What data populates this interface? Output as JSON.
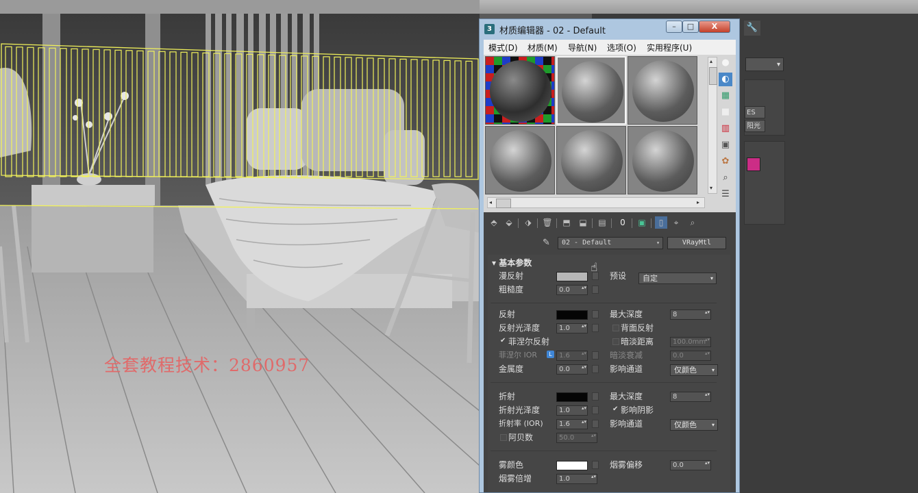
{
  "window": {
    "title": "材质编辑器 - 02 - Default",
    "icon_label": "3",
    "controls": {
      "minimize": "–",
      "maximize": "□",
      "close": "X"
    }
  },
  "menu": [
    "模式(D)",
    "材质(M)",
    "导航(N)",
    "选项(O)",
    "实用程序(U)"
  ],
  "slots": [
    {
      "selected": false,
      "checker": true
    },
    {
      "selected": true,
      "checker": false
    },
    {
      "selected": false,
      "checker": false
    },
    {
      "selected": false,
      "checker": false
    },
    {
      "selected": false,
      "checker": false
    },
    {
      "selected": false,
      "checker": false
    }
  ],
  "material": {
    "name": "02 - Default",
    "type": "VRayMtl"
  },
  "rollout": {
    "title": "基本参数",
    "diffuse": {
      "label": "漫反射",
      "color": "#b7b7b7"
    },
    "roughness": {
      "label": "粗糙度",
      "value": "0.0"
    },
    "preset": {
      "label": "预设",
      "value": "自定"
    },
    "reflect": {
      "label": "反射",
      "color": "#050505"
    },
    "reflect_gloss": {
      "label": "反射光泽度",
      "value": "1.0"
    },
    "fresnel": {
      "label": "菲涅尔反射",
      "checked": true
    },
    "fresnel_ior": {
      "label": "菲涅尔 IOR",
      "badge": "L",
      "value": "1.6"
    },
    "metalness": {
      "label": "金属度",
      "value": "0.0"
    },
    "max_depth_reflect": {
      "label": "最大深度",
      "value": "8"
    },
    "back_reflect": {
      "label": "背面反射",
      "checked": false
    },
    "dim_distance": {
      "label": "暗淡距离",
      "value": "100.0mm",
      "checked": false
    },
    "dim_falloff": {
      "label": "暗淡衰减",
      "value": "0.0"
    },
    "affect_channels_reflect": {
      "label": "影响通道",
      "value": "仅颜色"
    },
    "refract": {
      "label": "折射",
      "color": "#050505"
    },
    "refract_gloss": {
      "label": "折射光泽度",
      "value": "1.0"
    },
    "ior": {
      "label": "折射率 (IOR)",
      "value": "1.6"
    },
    "abbe": {
      "label": "阿贝数",
      "value": "50.0",
      "checked": false
    },
    "max_depth_refract": {
      "label": "最大深度",
      "value": "8"
    },
    "affect_shadows": {
      "label": "影响阴影",
      "checked": true
    },
    "affect_channels_refract": {
      "label": "影响通道",
      "value": "仅颜色"
    },
    "fog_color": {
      "label": "雾颜色",
      "color": "#ffffff"
    },
    "fog_multiplier": {
      "label": "烟雾倍增",
      "value": "1.0"
    },
    "fog_bias": {
      "label": "烟雾偏移",
      "value": "0.0"
    }
  },
  "viewport": {
    "watermark": "全套教程技术：2860957"
  },
  "command_panel": {
    "buttons": [
      "ES",
      "阳光"
    ],
    "swatch_color": "#cc2d86"
  },
  "icons": {
    "check": "✔",
    "dropdown": "▾",
    "spinner": "▴▾",
    "left": "◂",
    "right": "▸",
    "up": "▴",
    "down": "▾",
    "eyedropper": "✎",
    "wrench": "🔧",
    "hand": "☝"
  }
}
